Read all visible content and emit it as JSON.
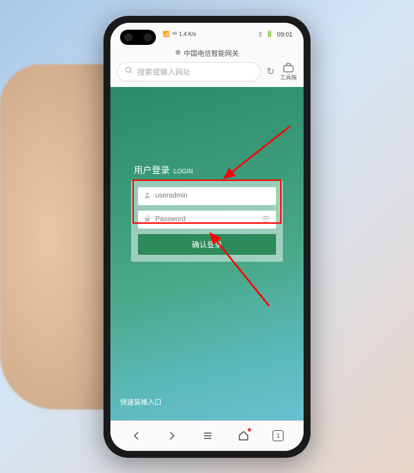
{
  "status": {
    "signal_text": "⁴ᴳ",
    "network": "1.4 K/s",
    "bt": "BT",
    "battery": "▮",
    "time": "09:01"
  },
  "browser": {
    "page_title": "中国电信智能网关",
    "search_placeholder": "搜索或输入网址",
    "toolbox_label": "工具箱"
  },
  "login": {
    "title": "用户登录",
    "title_sub": "LOGIN",
    "username_value": "useradmin",
    "password_placeholder": "Password",
    "submit_label": "确认登录"
  },
  "footer": {
    "quick_install": "快速装维入口"
  },
  "nav": {
    "tab_count": "1"
  }
}
